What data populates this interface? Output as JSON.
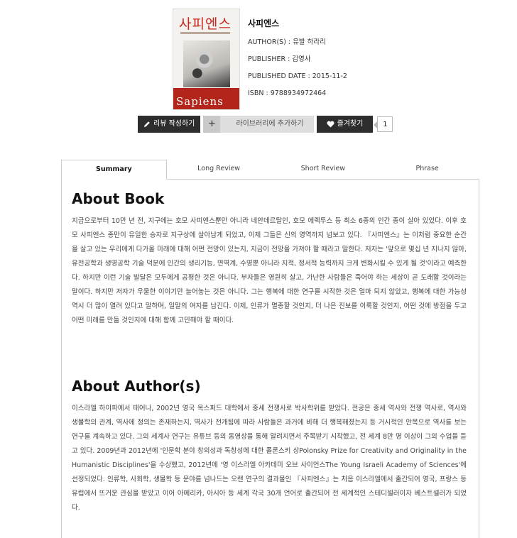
{
  "book": {
    "cover_title_ko": "사피엔스",
    "cover_title_en": "Sapiens",
    "title": "사피엔스",
    "author": "AUTHOR(S) : 유발 하라리",
    "publisher": "PUBLISHER : 김영사",
    "published_date": "PUBLISHED DATE : 2015-11-2",
    "isbn": "ISBN : 9788934972464"
  },
  "actions": {
    "review_label": "리뷰 작성하기",
    "library_label": "라이브러리에 추가하기",
    "favorite_label": "즐겨찾기",
    "favorite_count": "1"
  },
  "tabs": [
    "Summary",
    "Long Review",
    "Short Review",
    "Phrase"
  ],
  "about_book": {
    "heading": "About Book",
    "text": "지금으로부터 10만 년 전, 지구에는 호모 사피엔스뿐만 아니라 네안데르탈인, 호모 에렉투스 등 최소 6종의 인간 종이 살아 있었다. 이후 호모 사피엔스 종만이 유일한 승자로 지구상에 살아남게 되었고, 이제 그들은 신의 영역까지 넘보고 있다. 『사피엔스』는 이처럼 중요한 순간을 살고 있는 우리에게 다가올 미래에 대해 어떤 전망이 있는지, 지금이 전망을 가져야 할 때라고 말한다. 저자는 '앞으로 몇십 년 지나지 않아, 유전공학과 생명공학 기술 덕분에 인간의 생리기능, 면역계, 수명뿐 아니라 지적, 정서적 능력까지 크게 변화시킬 수 있게 될 것'이라고 예측한다. 하지만 이런 기술 발달은 모두에게 공평한 것은 아니다. 부자들은 영원히 살고, 가난한 사람들은 죽어야 하는 세상이 곧 도래할 것이라는 말이다. 하지만 저자가 우울한 이야기만 늘어놓는 것은 아니다. 그는 행복에 대한 연구를 시작한 것은 얼마 되지 않았고, 행복에 대한 가능성 역시 더 많이 열려 있다고 말하며, 일말의 여지를 남긴다. 이제, 인류가 멸종할 것인지, 더 나은 진보를 이룩할 것인지, 어떤 것에 방점을 두고 어떤 미래를 만들 것인지에 대해 함께 고민해야 할 때이다."
  },
  "about_author": {
    "heading": "About Author(s)",
    "text": "이스라엘 하이파에서 태어나, 2002년 영국 옥스퍼드 대학에서 중세 전쟁사로 박사학위를 받았다. 전공은 중세 역사와 전쟁 역사로, 역사와 생물학의 관계, 역사에 정의는 존재하는지, 역사가 전개됨에 따라 사람들은 과거에 비해 더 행복해졌는지 등 거시적인 안목으로 역사를 보는 연구를 계속하고 있다. 그의 세계사 연구는 유튜브 등의 동영상을 통해 알려지면서 주목받기 시작했고, 전 세계 8만 명 이상이 그의 수업을 듣고 있다. 2009년과 2012년에 '인문학 분야 창의성과 독창성에 대한 폴론스키 상Polonsky Prize for Creativity and Originality in the Humanistic Disciplines'을 수상했고, 2012년에 '영 이스라엘 아카데미 오브 사이언스The Young Israeli Academy of Sciences'에 선정되었다. 인류학, 사회학, 생물학 등 문야를 넘나드는 오랜 연구의 결과물인 『사피엔스』는 처음 이스라엘에서 출간되어 영국, 프랑스 등 유럽에서 뜨거운 관심을 받았고 이어 아메리카, 아시아 등 세계 각국 30개 언어로 출간되어 전 세계적인 스테디셀러이자 베스트셀러가 되었다."
  }
}
